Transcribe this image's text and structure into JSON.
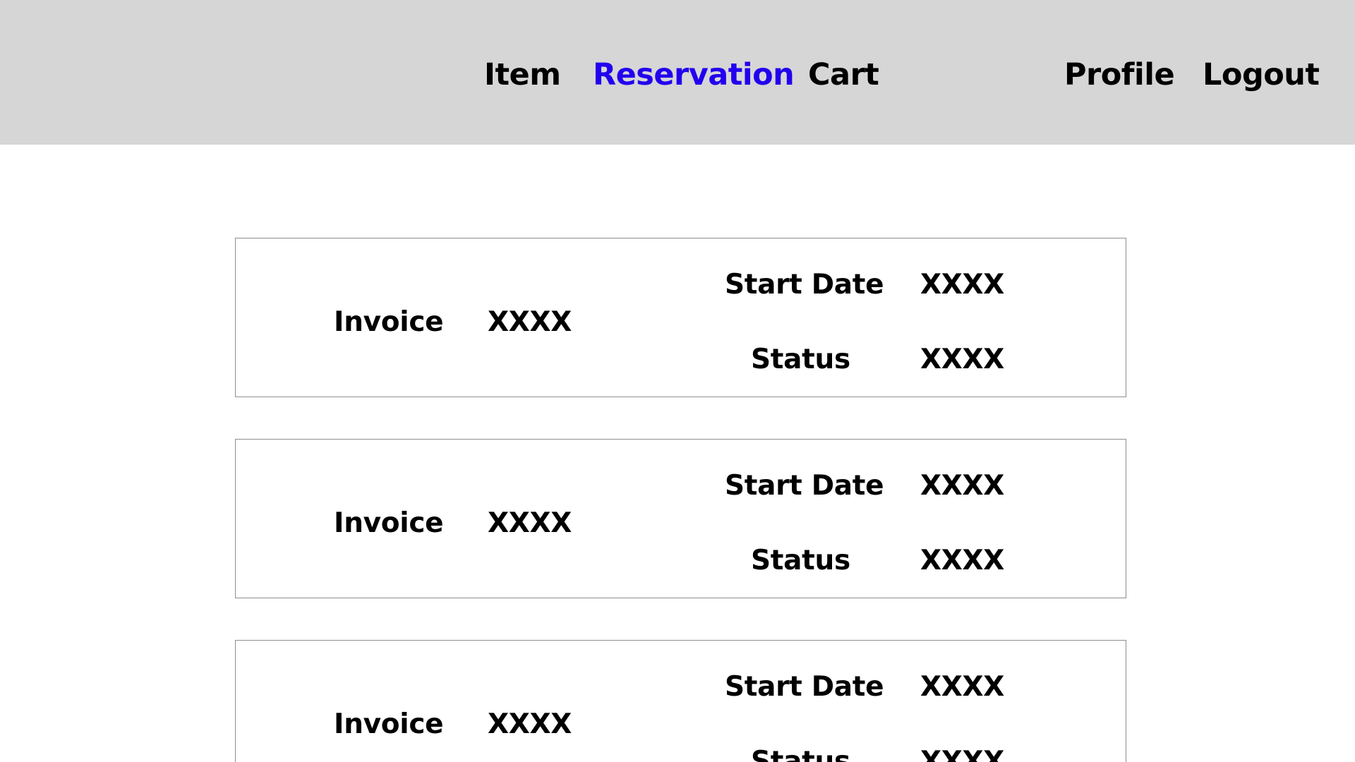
{
  "nav": {
    "item": "Item",
    "reservation": "Reservation",
    "cart": "Cart",
    "profile": "Profile",
    "logout": "Logout",
    "active": "reservation",
    "active_color": "#2200ee",
    "background_color": "#d6d6d6"
  },
  "reservations": [
    {
      "invoice_label": "Invoice",
      "invoice_value": "XXXX",
      "start_date_label": "Start Date",
      "start_date_value": "XXXX",
      "status_label": "Status",
      "status_value": "XXXX"
    },
    {
      "invoice_label": "Invoice",
      "invoice_value": "XXXX",
      "start_date_label": "Start Date",
      "start_date_value": "XXXX",
      "status_label": "Status",
      "status_value": "XXXX"
    },
    {
      "invoice_label": "Invoice",
      "invoice_value": "XXXX",
      "start_date_label": "Start Date",
      "start_date_value": "XXXX",
      "status_label": "Status",
      "status_value": "XXXX"
    }
  ]
}
